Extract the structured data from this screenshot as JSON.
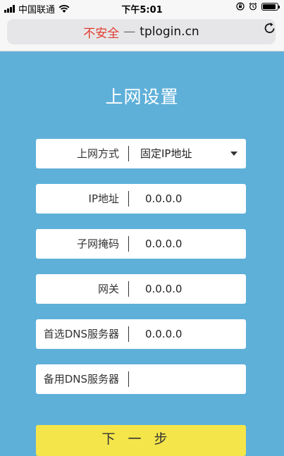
{
  "status_bar": {
    "carrier": "中国联通",
    "time": "下午5:01"
  },
  "address_bar": {
    "security_text": "不安全",
    "separator": "—",
    "url": "tplogin.cn"
  },
  "page": {
    "title": "上网设置",
    "fields": [
      {
        "label": "上网方式",
        "value": "固定IP地址"
      },
      {
        "label": "IP地址",
        "value": "0.0.0.0"
      },
      {
        "label": "子网掩码",
        "value": "0.0.0.0"
      },
      {
        "label": "网关",
        "value": "0.0.0.0"
      },
      {
        "label": "首选DNS服务器",
        "value": "0.0.0.0"
      },
      {
        "label": "备用DNS服务器",
        "value": ""
      }
    ],
    "next_button": "下一步"
  },
  "colors": {
    "background": "#5eb0d9",
    "insecure": "#e23b2e",
    "button": "#f4e54a"
  },
  "icons": [
    "signal-icon",
    "wifi-icon",
    "screen-rotation-lock-icon",
    "alarm-icon",
    "battery-icon",
    "reload-icon",
    "dropdown-caret-icon"
  ]
}
